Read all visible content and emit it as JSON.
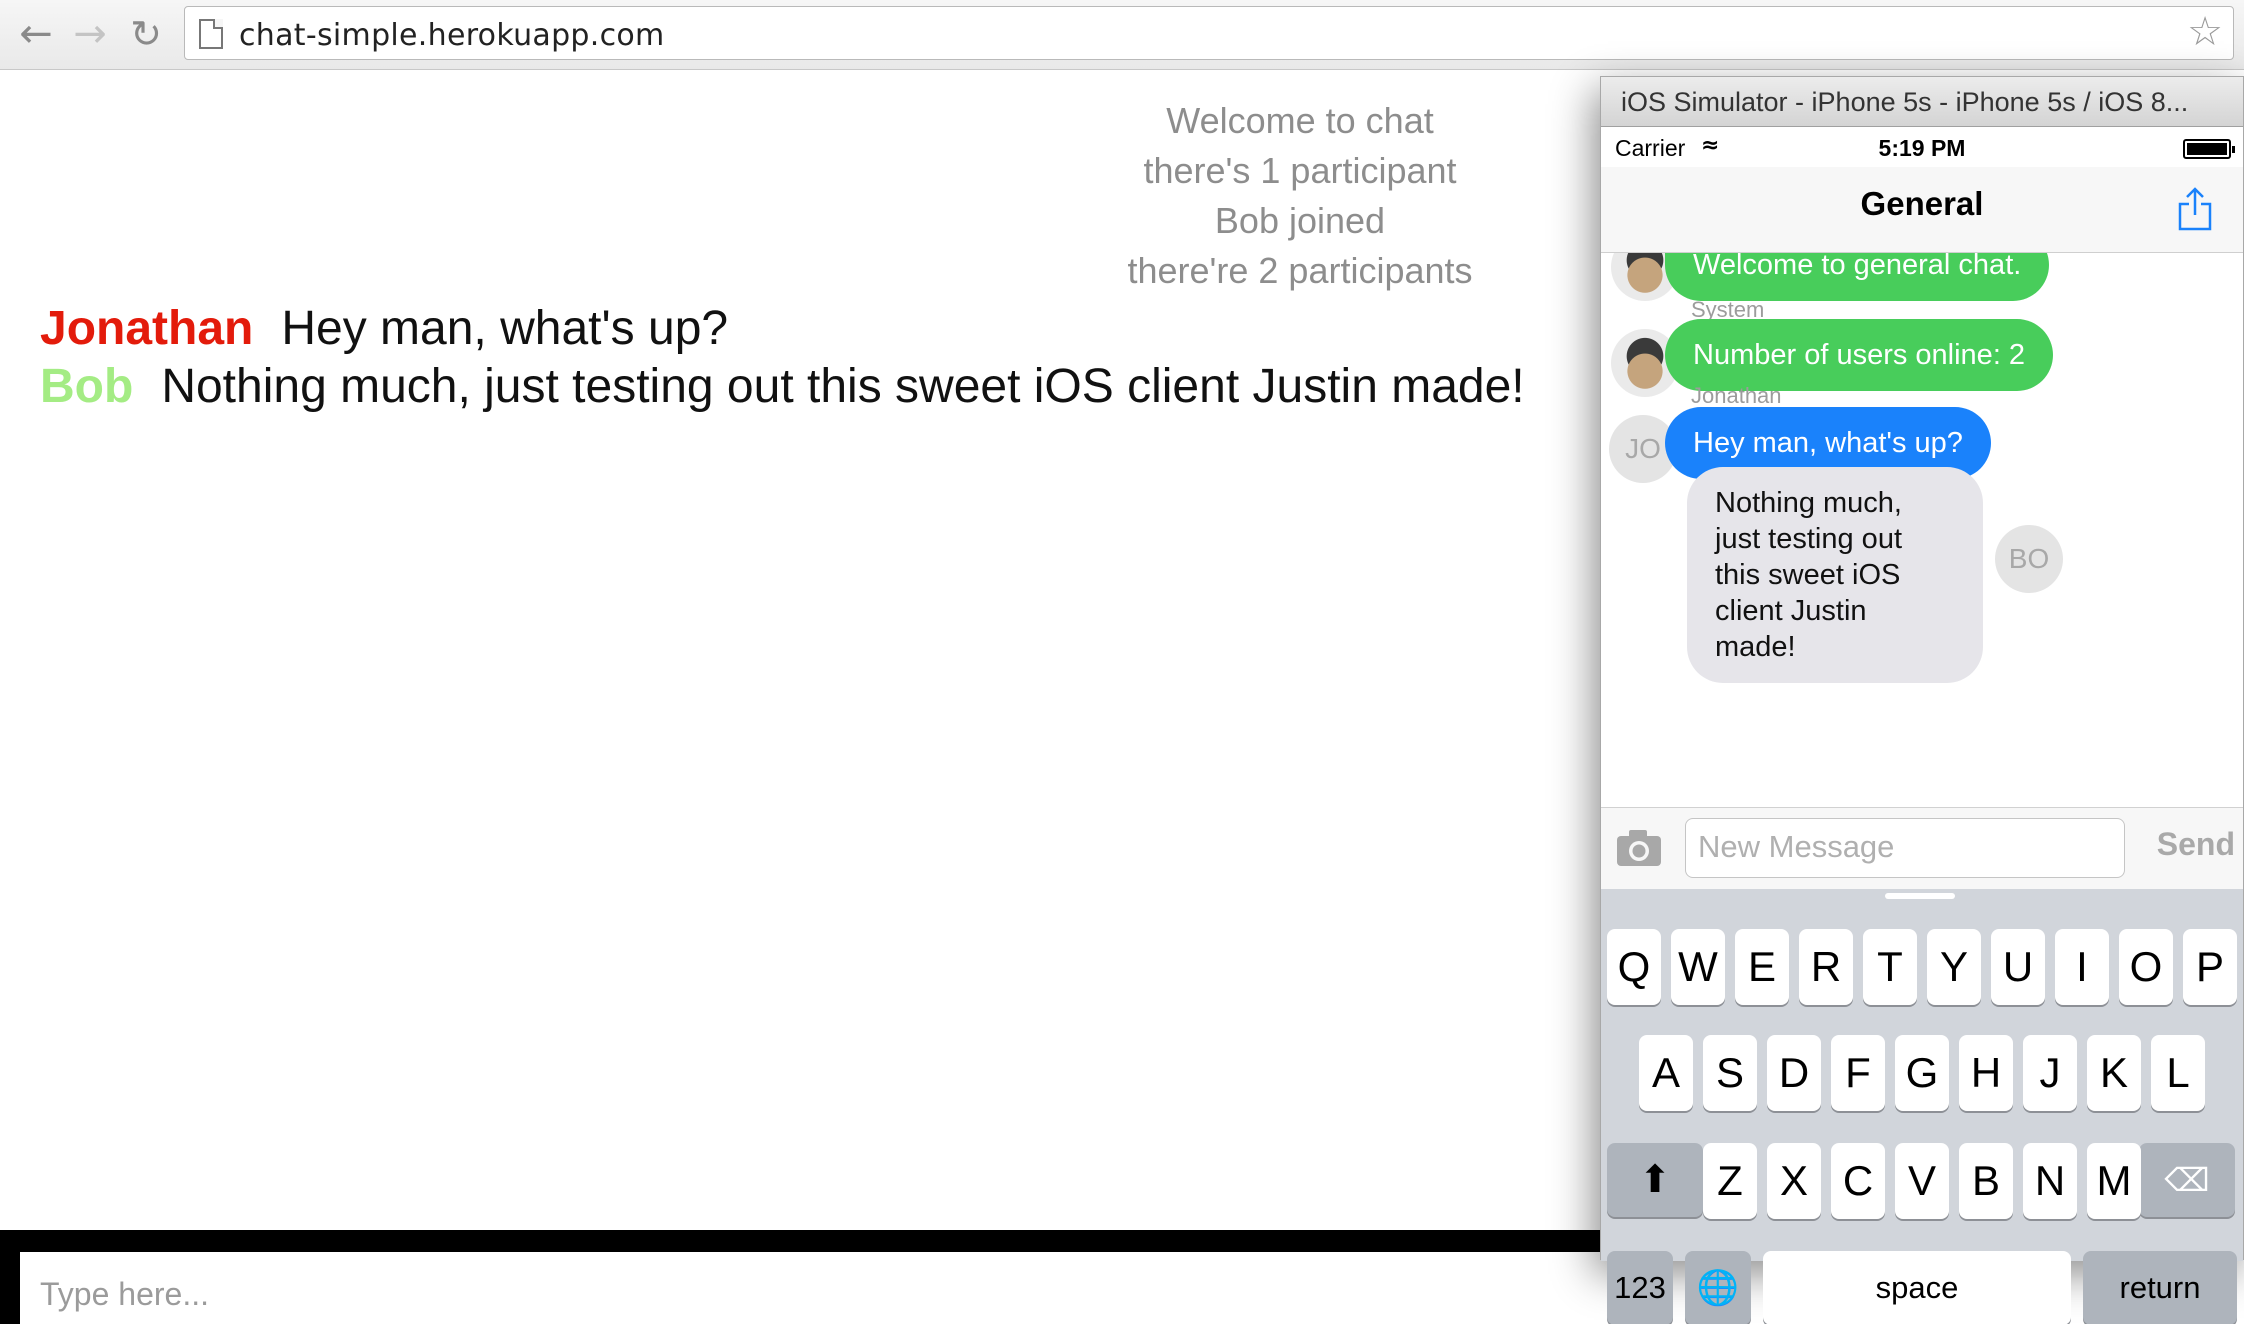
{
  "browser": {
    "url": "chat-simple.herokuapp.com",
    "back_icon": "back-arrow-icon",
    "forward_icon": "forward-arrow-icon",
    "reload_icon": "reload-icon",
    "bookmark_icon": "star-icon"
  },
  "web_chat": {
    "system_notices": [
      "Welcome to chat",
      "there's 1 participant",
      "Bob joined",
      "there're 2 participants"
    ],
    "messages": [
      {
        "user": "Jonathan",
        "text": "Hey man, what's up?",
        "color": "#e31b0b"
      },
      {
        "user": "Bob",
        "text": "Nothing much, just testing out this sweet iOS client Justin made!",
        "color": "#a4ec84"
      }
    ],
    "input_placeholder": "Type here..."
  },
  "simulator": {
    "window_title": "iOS Simulator - iPhone 5s - iPhone 5s / iOS 8...",
    "status": {
      "carrier": "Carrier",
      "time": "5:19 PM"
    },
    "nav_title": "General",
    "messages": [
      {
        "sender": "",
        "text": "Welcome to general chat.",
        "style": "green"
      },
      {
        "sender": "System",
        "text": "Number of users online: 2",
        "style": "green"
      },
      {
        "sender": "Jonathan",
        "avatar": "JO",
        "text": "Hey man, what's up?",
        "style": "blue"
      },
      {
        "sender": "",
        "avatar": "BO",
        "text": "Nothing much, just testing out this sweet iOS client Justin made!",
        "style": "gray"
      }
    ],
    "input_placeholder": "New Message",
    "send_label": "Send",
    "keyboard": {
      "row1": [
        "Q",
        "W",
        "E",
        "R",
        "T",
        "Y",
        "U",
        "I",
        "O",
        "P"
      ],
      "row2": [
        "A",
        "S",
        "D",
        "F",
        "G",
        "H",
        "J",
        "K",
        "L"
      ],
      "row3": [
        "Z",
        "X",
        "C",
        "V",
        "B",
        "N",
        "M"
      ],
      "numbers_label": "123",
      "space_label": "space",
      "return_label": "return"
    }
  }
}
